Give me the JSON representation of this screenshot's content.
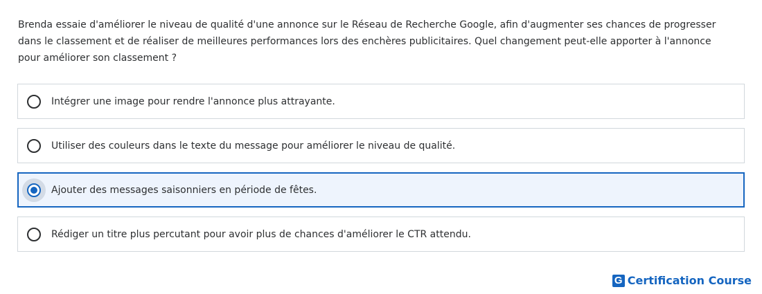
{
  "question": {
    "text": "Brenda essaie d'améliorer le niveau de qualité d'une annonce sur le Réseau de Recherche Google, afin d'augmenter ses chances de progresser dans le classement et de réaliser de meilleures performances lors des enchères publicitaires. Quel changement peut-elle apporter à l'annonce pour améliorer son classement ?"
  },
  "options": [
    {
      "label": "Intégrer une image pour rendre l'annonce plus attrayante.",
      "selected": false
    },
    {
      "label": "Utiliser des couleurs dans le texte du message pour améliorer le niveau de qualité.",
      "selected": false
    },
    {
      "label": "Ajouter des messages saisonniers en période de fêtes.",
      "selected": true
    },
    {
      "label": "Rédiger un titre plus percutant pour avoir plus de chances d'améliorer le CTR attendu.",
      "selected": false
    }
  ],
  "brand": {
    "logo_letter": "G",
    "name": "Certification Course"
  },
  "colors": {
    "accent": "#1565c0",
    "selected_background": "#eef4fd",
    "border": "#d1d7dc",
    "text": "#2d2f31"
  }
}
